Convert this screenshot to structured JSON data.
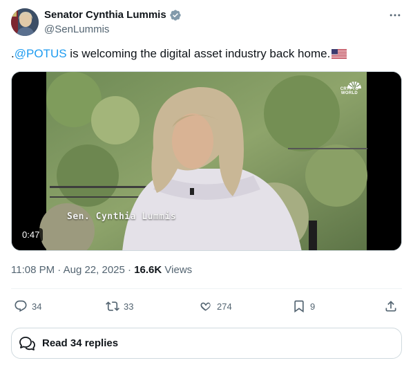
{
  "author": {
    "display_name": "Senator Cynthia Lummis",
    "handle": "@SenLummis",
    "verified": true
  },
  "tweet": {
    "prefix": ".",
    "mention": "@POTUS",
    "text": " is welcoming the digital asset industry back home.",
    "emoji": "us-flag"
  },
  "media": {
    "duration": "0:47",
    "lower_third": "Sen. Cynthia Lummis",
    "network_logo_text": "CRYPTO WORLD"
  },
  "meta": {
    "time": "11:08 PM",
    "separator": " · ",
    "date": "Aug 22, 2025",
    "views_count": "16.6K",
    "views_label": "Views"
  },
  "actions": {
    "replies": "34",
    "reposts": "33",
    "likes": "274",
    "bookmarks": "9"
  },
  "replies_button": {
    "label": "Read 34 replies"
  },
  "colors": {
    "link": "#1d9bf0",
    "verified": "#829aab",
    "text_secondary": "#536471",
    "border": "#cfd9de"
  },
  "icons": [
    "verified-badge-icon",
    "more-icon",
    "reply-icon",
    "repost-icon",
    "like-icon",
    "bookmark-icon",
    "share-icon",
    "chat-bubbles-icon"
  ]
}
